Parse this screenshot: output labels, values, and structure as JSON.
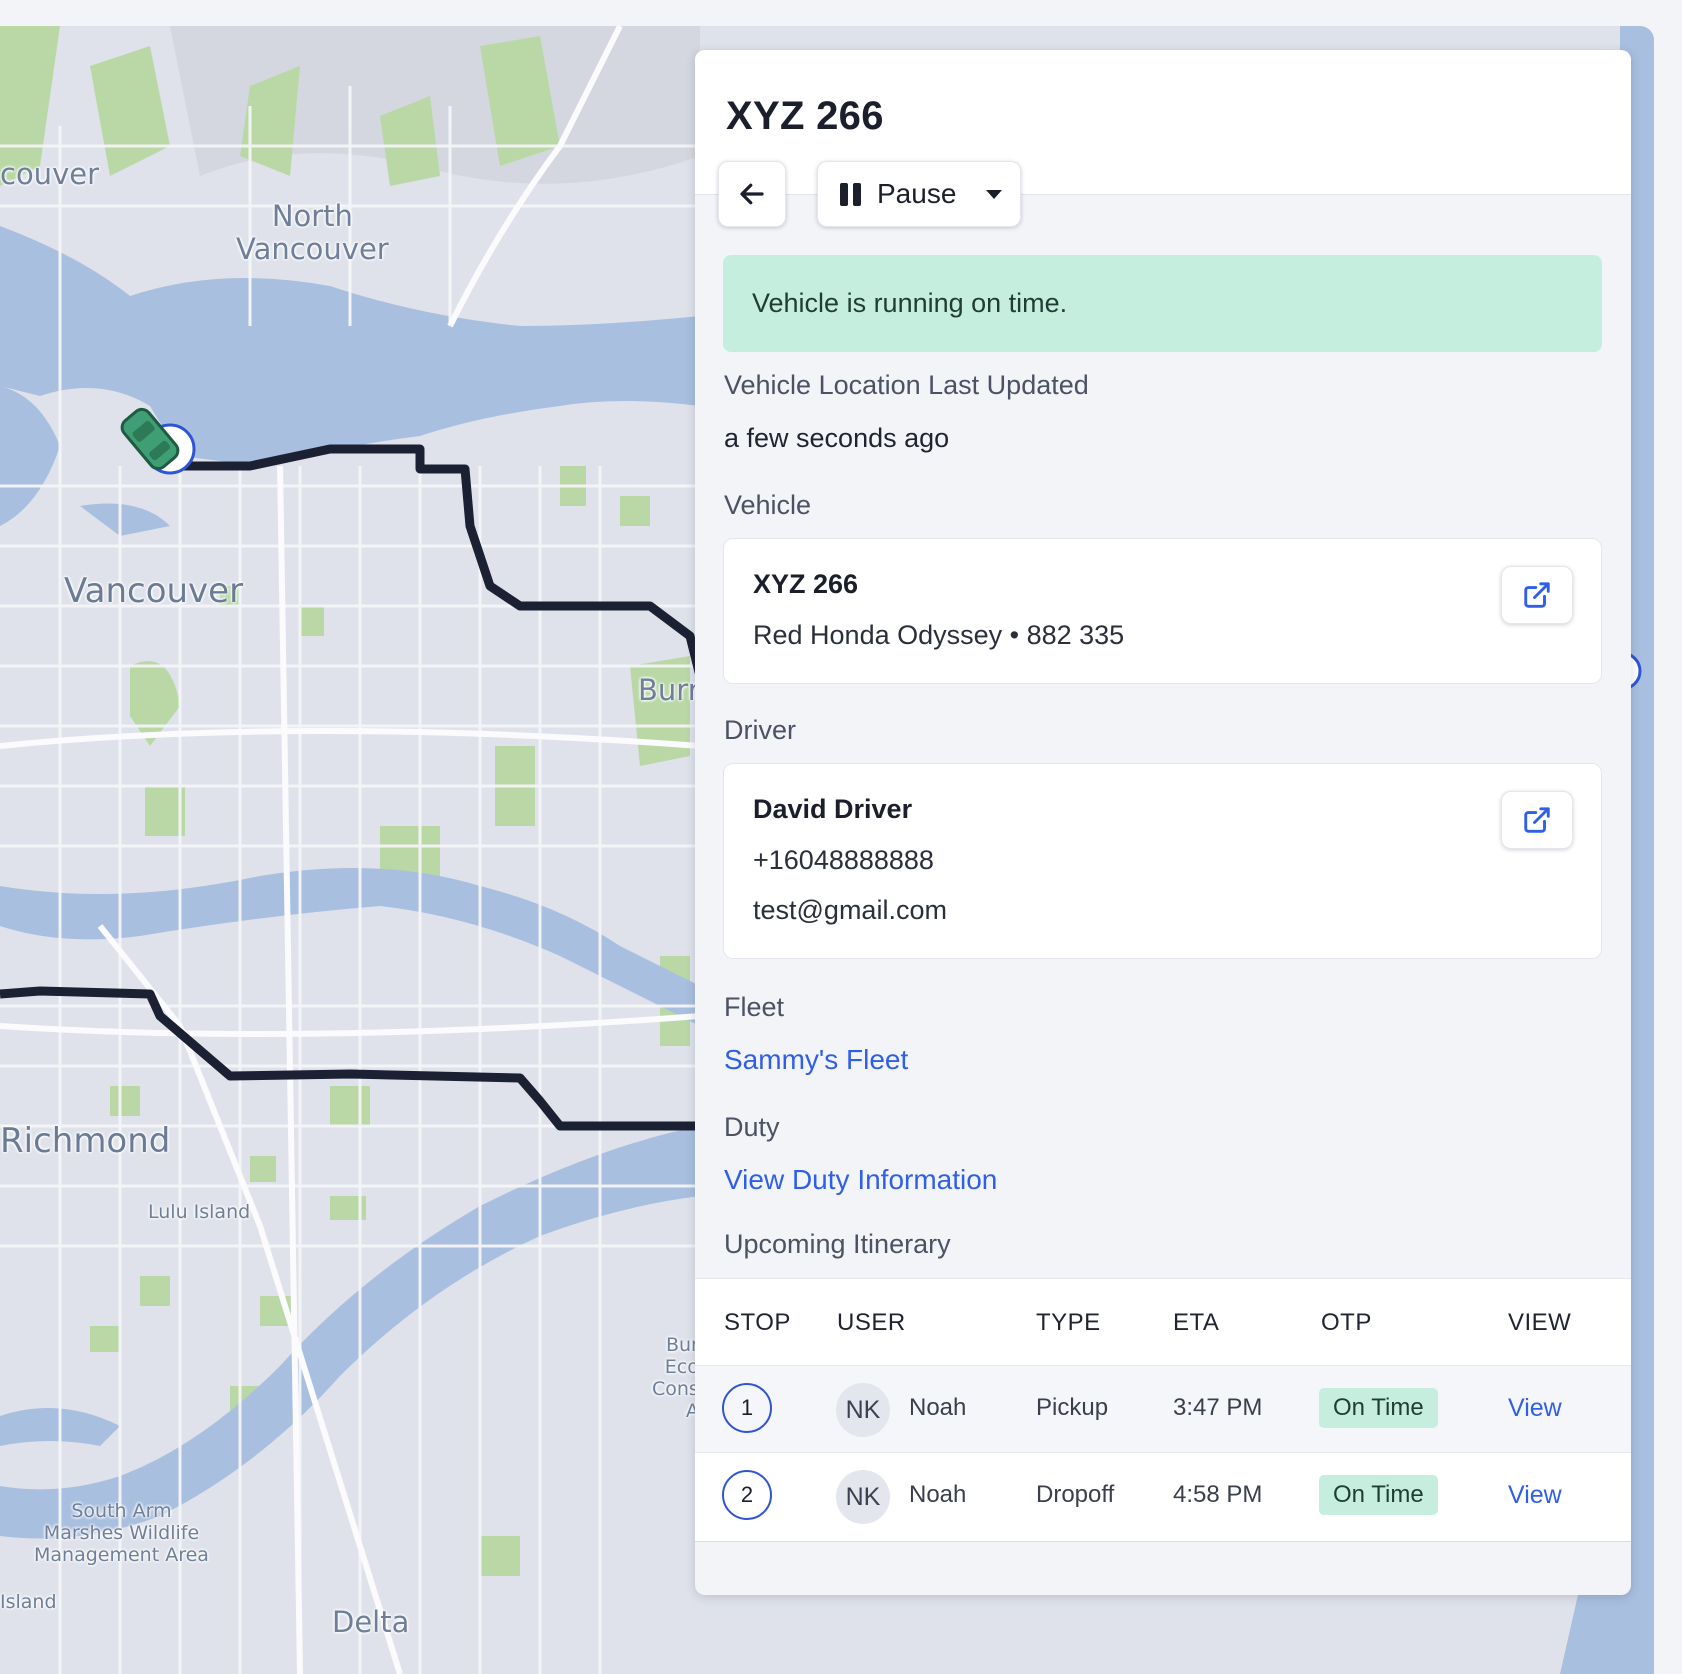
{
  "map": {
    "labels": {
      "vancouver_partial": "couver",
      "north_vancouver": "North\nVancouver",
      "vancouver": "Vancouver",
      "burnaby_partial": "Burr",
      "richmond": "Richmond",
      "lulu_island": "Lulu Island",
      "burns_bog_partial": "Bur\nEco\nCons\nA",
      "south_arm": "South Arm\nMarshes Wildlife\nManagement Area",
      "island_partial": "Island",
      "delta": "Delta"
    },
    "colors": {
      "water": "#a9bfdf",
      "land": "#dfe2ea",
      "park": "#b9d8a6",
      "road": "#f4f5f8",
      "route": "#1c2033",
      "vehicle": "#3f9e74"
    },
    "vehicle_icon": "car-icon"
  },
  "panel": {
    "title": "XYZ 266",
    "back_icon": "arrow-left-icon",
    "pause_label": "Pause",
    "status_banner": "Vehicle is running on time.",
    "location_label": "Vehicle Location Last Updated",
    "location_value": "a few seconds ago",
    "vehicle_label": "Vehicle",
    "vehicle": {
      "name": "XYZ 266",
      "details": "Red Honda Odyssey • 882 335"
    },
    "driver_label": "Driver",
    "driver": {
      "name": "David Driver",
      "phone": "+16048888888",
      "email": "test@gmail.com"
    },
    "fleet_label": "Fleet",
    "fleet_link": "Sammy's Fleet",
    "duty_label": "Duty",
    "duty_link": "View Duty Information",
    "itinerary_label": "Upcoming Itinerary",
    "itinerary": {
      "headers": [
        "STOP",
        "USER",
        "TYPE",
        "ETA",
        "OTP",
        "VIEW"
      ],
      "rows": [
        {
          "stop": "1",
          "initials": "NK",
          "user": "Noah",
          "type": "Pickup",
          "eta": "3:47 PM",
          "otp": "On Time",
          "view": "View"
        },
        {
          "stop": "2",
          "initials": "NK",
          "user": "Noah",
          "type": "Dropoff",
          "eta": "4:58 PM",
          "otp": "On Time",
          "view": "View"
        }
      ]
    }
  }
}
